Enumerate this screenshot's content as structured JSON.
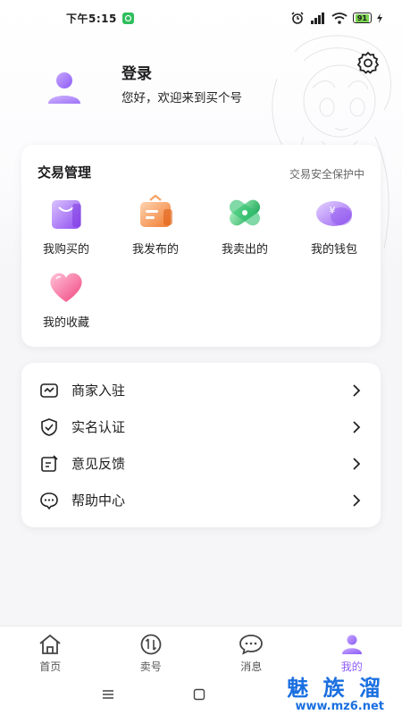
{
  "status_bar": {
    "time": "下午5:15",
    "battery": "91"
  },
  "profile": {
    "title": "登录",
    "welcome": "您好，欢迎来到买个号"
  },
  "trade": {
    "title": "交易管理",
    "safe_label": "交易安全保护中",
    "items": [
      {
        "label": "我购买的",
        "icon": "shopping-bag-icon"
      },
      {
        "label": "我发布的",
        "icon": "publish-box-icon"
      },
      {
        "label": "我卖出的",
        "icon": "sold-tag-icon"
      },
      {
        "label": "我的钱包",
        "icon": "wallet-yen-icon"
      },
      {
        "label": "我的收藏",
        "icon": "heart-icon"
      }
    ]
  },
  "menu": [
    {
      "label": "商家入驻",
      "icon": "store-icon"
    },
    {
      "label": "实名认证",
      "icon": "shield-check-icon"
    },
    {
      "label": "意见反馈",
      "icon": "feedback-edit-icon"
    },
    {
      "label": "帮助中心",
      "icon": "help-chat-icon"
    }
  ],
  "bottom_nav": {
    "tabs": [
      {
        "label": "首页",
        "icon": "home-icon"
      },
      {
        "label": "卖号",
        "icon": "sell-arrows-icon"
      },
      {
        "label": "消息",
        "icon": "message-icon"
      },
      {
        "label": "我的",
        "icon": "profile-icon"
      }
    ],
    "active": "我的"
  },
  "watermark": {
    "top": "魅 族 溜",
    "bottom": "www.mz6.net"
  },
  "colors": {
    "accent": "#8d5cf6",
    "background": "#f6f6f8",
    "card": "#ffffff"
  }
}
